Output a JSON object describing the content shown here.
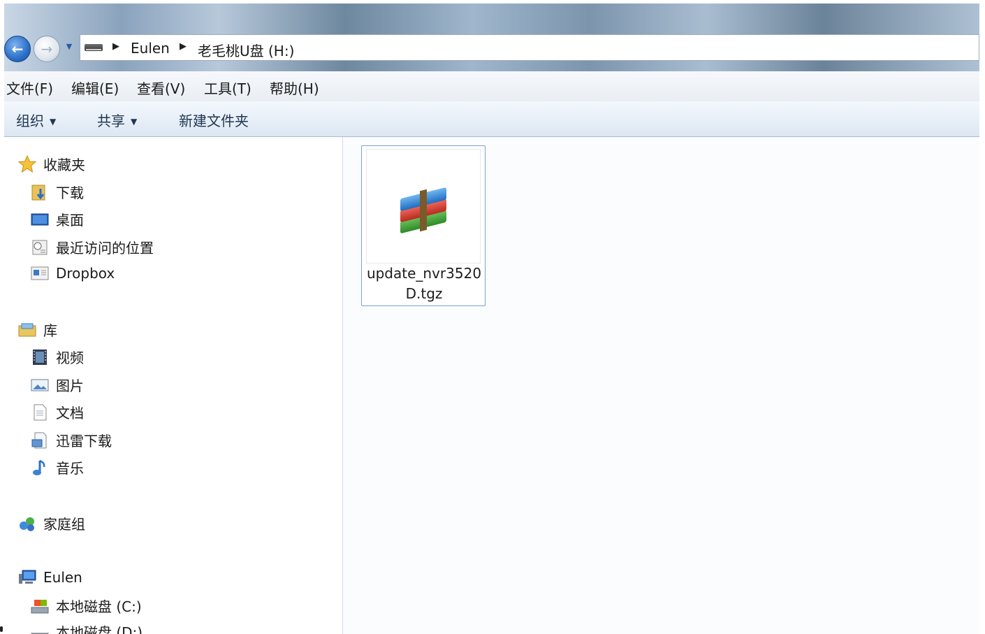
{
  "window": {
    "address": {
      "drive_icon": "usb-drive-icon",
      "crumbs": [
        "Eulen",
        "老毛桃U盘 (H:)"
      ]
    }
  },
  "menubar": {
    "items": [
      "文件(F)",
      "编辑(E)",
      "查看(V)",
      "工具(T)",
      "帮助(H)"
    ]
  },
  "toolbar": {
    "organize": "组织",
    "share": "共享",
    "new_folder": "新建文件夹"
  },
  "navpane": {
    "favorites": {
      "label": "收藏夹",
      "items": [
        "下载",
        "桌面",
        "最近访问的位置",
        "Dropbox"
      ]
    },
    "libraries": {
      "label": "库",
      "items": [
        "视频",
        "图片",
        "文档",
        "迅雷下载",
        "音乐"
      ]
    },
    "homegroup": {
      "label": "家庭组"
    },
    "computer": {
      "label": "Eulen",
      "items": [
        "本地磁盘 (C:)",
        "本地磁盘 (D:)"
      ]
    }
  },
  "content": {
    "files": [
      {
        "name_line1": "update_nvr3520",
        "name_line2": "D.tgz",
        "icon": "winrar-archive-icon"
      }
    ]
  },
  "colors": {
    "selection_border": "#7da2ce",
    "toolbar_text": "#1f3550",
    "back_button": "#2a6fc9"
  }
}
